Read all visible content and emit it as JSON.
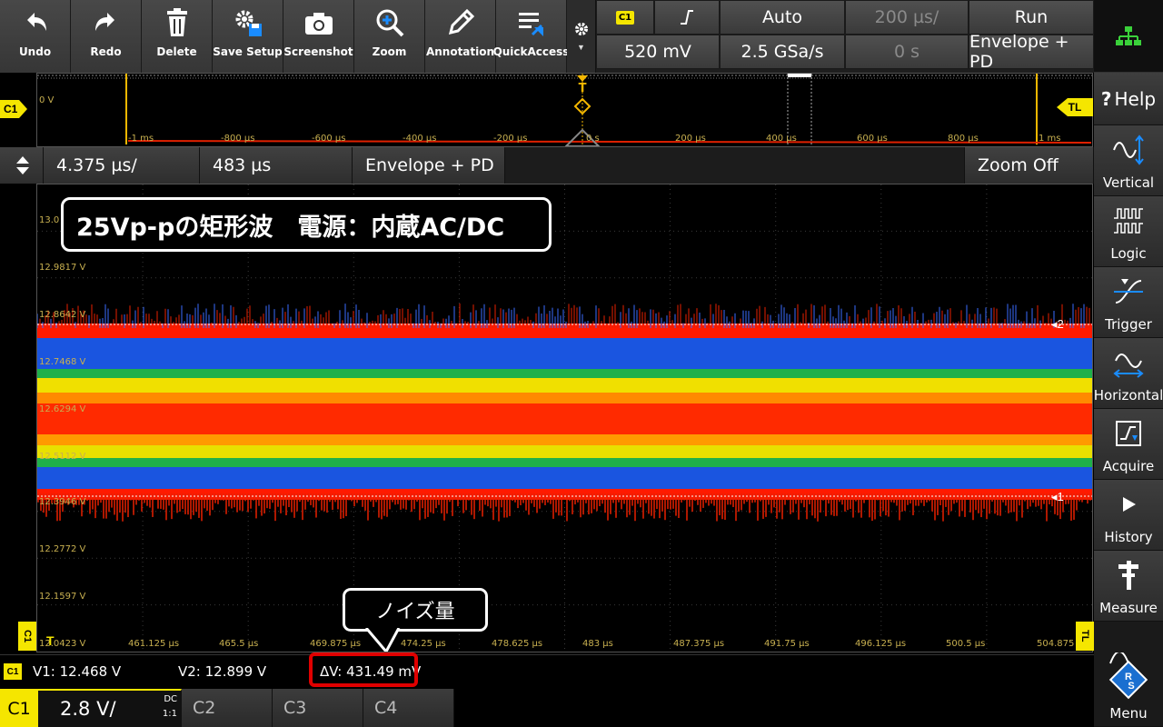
{
  "toolbar": {
    "buttons": [
      {
        "label": "Undo",
        "icon": "undo-arrow-icon"
      },
      {
        "label": "Redo",
        "icon": "redo-arrow-icon"
      },
      {
        "label": "Delete",
        "icon": "trash-icon"
      },
      {
        "label": "Save Setup",
        "icon": "gear-save-icon"
      },
      {
        "label": "Screenshot",
        "icon": "camera-icon"
      },
      {
        "label": "Zoom",
        "icon": "magnifier-plus-icon"
      },
      {
        "label": "Annotation",
        "icon": "pencil-icon"
      },
      {
        "label": "QuickAccess",
        "icon": "quick-access-icon"
      }
    ]
  },
  "settings": {
    "channel_tag": "C1",
    "trigger_level": "520 mV",
    "trigger_mode": "Auto",
    "sample_rate": "2.5 GSa/s",
    "time_base": "200 µs/",
    "time_offset": "0 s",
    "run_state": "Run",
    "acq_mode": "Envelope + PD"
  },
  "sidebar": {
    "help": "Help",
    "items": [
      "Vertical",
      "Logic",
      "Trigger",
      "Horizontal",
      "Acquire",
      "History",
      "Measure"
    ],
    "menu": "Menu"
  },
  "overview": {
    "ticks": [
      "-1 ms",
      "-800 µs",
      "-600 µs",
      "-400 µs",
      "-200 µs",
      "0 s",
      "200 µs",
      "400 µs",
      "600 µs",
      "800 µs",
      "1 ms"
    ],
    "zero_label": "0 V",
    "c1_tag": "C1",
    "tl_tag": "TL"
  },
  "zoombar": {
    "time_scale": "4.375 µs/",
    "position": "483 µs",
    "mode": "Envelope + PD",
    "zoom": "Zoom Off"
  },
  "waveform": {
    "y_labels": [
      "13.0",
      "12.9817 V",
      "12.8642 V",
      "12.7468 V",
      "12.6294 V",
      "12.5112 V",
      "12.3946 V",
      "12.2772 V",
      "12.1597 V",
      "12.0423 V"
    ],
    "x_labels": [
      "461.125 µs",
      "465.5 µs",
      "469.875 µs",
      "474.25 µs",
      "478.625 µs",
      "483 µs",
      "487.375 µs",
      "491.75 µs",
      "496.125 µs",
      "500.5 µs",
      "504.875"
    ],
    "cursor2_tag": "2",
    "cursor1_tag": "1",
    "annotation_title": "25Vp-pの矩形波　電源：内蔵AC/DC",
    "annotation_noise": "ノイズ量",
    "c1_tag": "C1",
    "tl_tag": "TL"
  },
  "cursors": {
    "channel_tag": "C1",
    "v1": "V1: 12.468 V",
    "v2": "V2: 12.899 V",
    "dv": "ΔV: 431.49 mV"
  },
  "channels": {
    "c1": {
      "label": "C1",
      "scale": "2.8 V/",
      "coupling": "DC",
      "probe": "1:1"
    },
    "others": [
      "C2",
      "C3",
      "C4"
    ]
  },
  "colors": {
    "channel1": "#f5e600",
    "trace_red": "#ff1a00",
    "trace_blue": "#1a55e0",
    "highlight_box": "#e00000"
  }
}
